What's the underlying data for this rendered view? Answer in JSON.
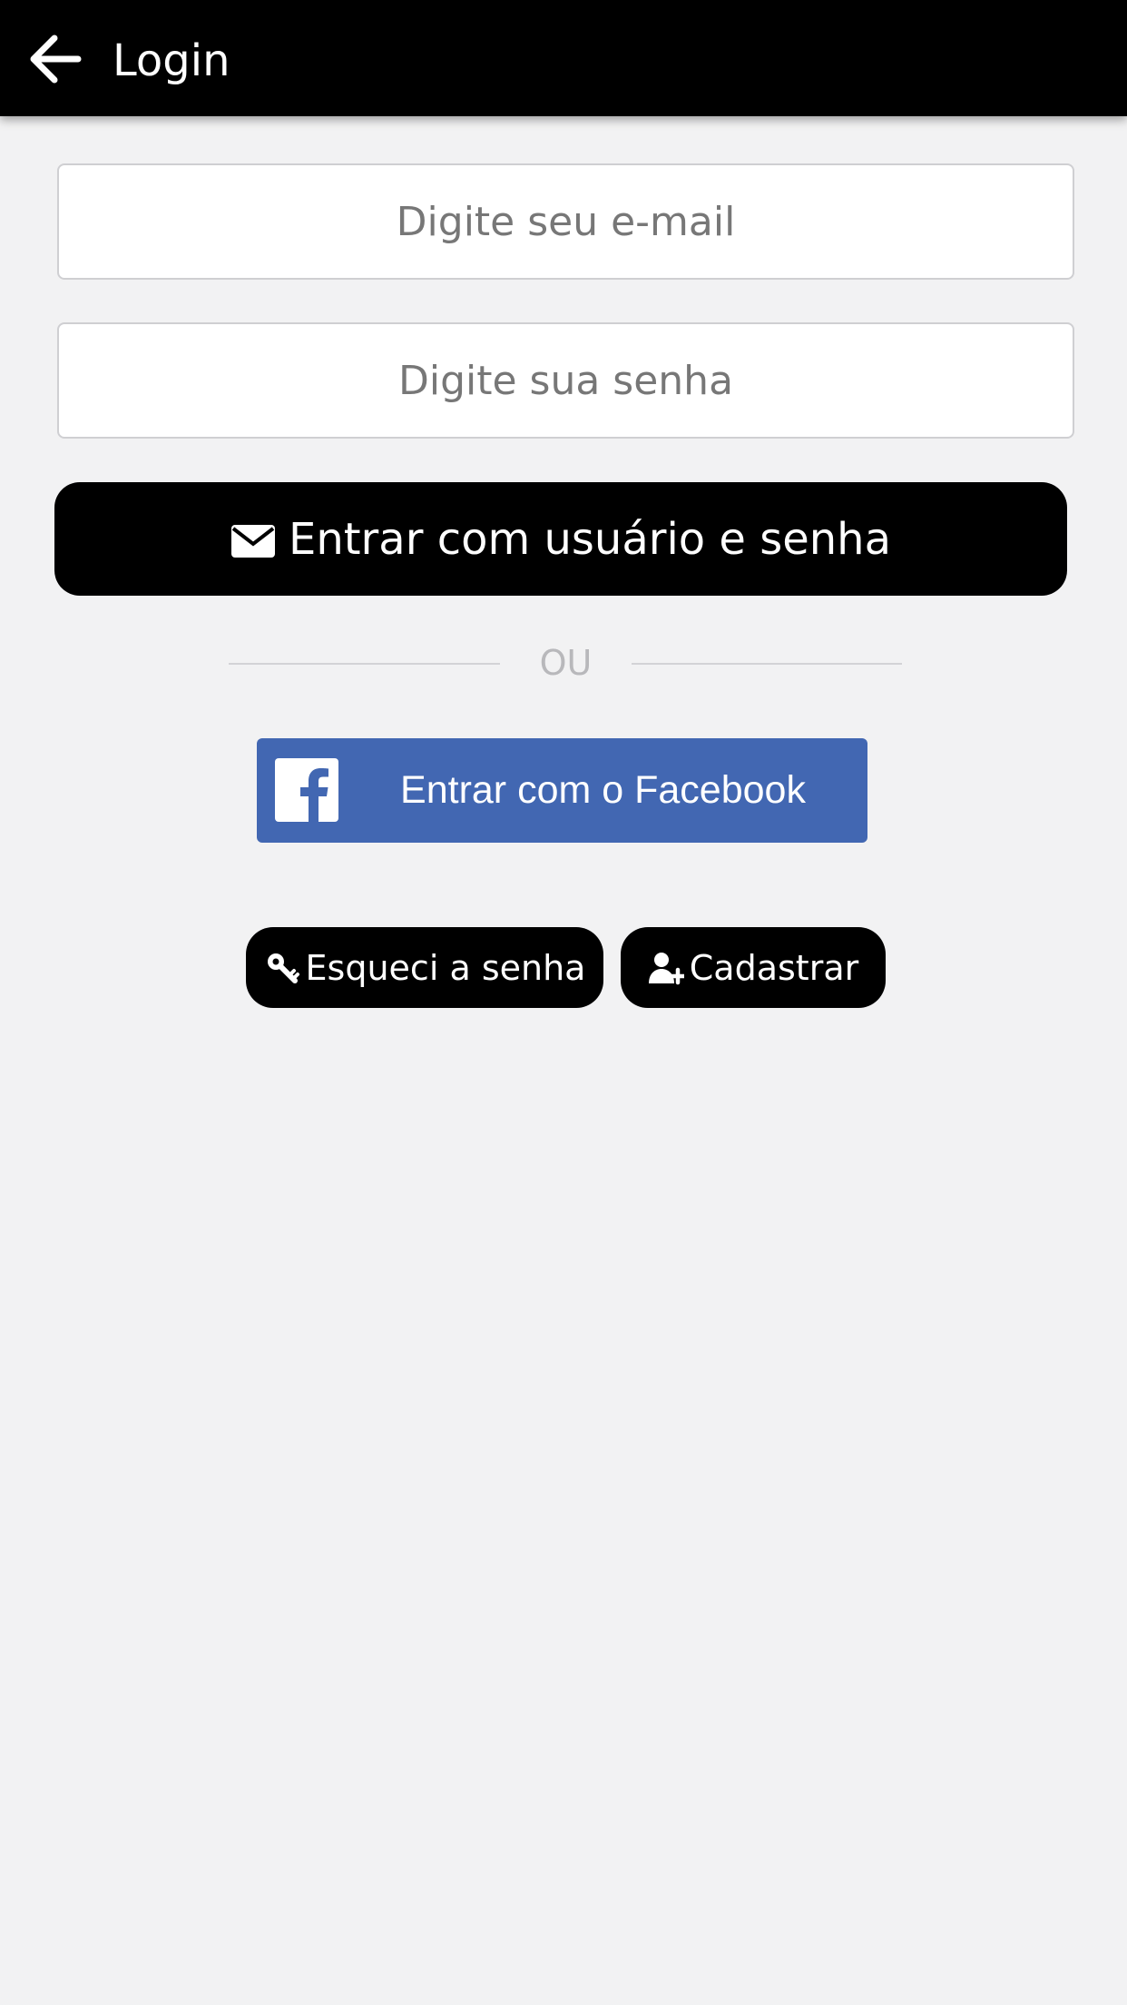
{
  "header": {
    "title": "Login",
    "back_icon": "arrow-left-icon"
  },
  "form": {
    "email_placeholder": "Digite seu e-mail",
    "password_placeholder": "Digite sua senha",
    "login_button_label": "Entrar com usuário e senha",
    "login_button_icon": "envelope-icon"
  },
  "divider": {
    "text": "OU"
  },
  "facebook": {
    "label": "Entrar com o Facebook",
    "icon": "facebook-icon",
    "color": "#4267b2"
  },
  "actions": {
    "forgot_label": "Esqueci a senha",
    "forgot_icon": "key-icon",
    "signup_label": "Cadastrar",
    "signup_icon": "user-plus-icon"
  },
  "colors": {
    "header_bg": "#000000",
    "page_bg": "#f2f2f3",
    "button_bg": "#000000"
  }
}
